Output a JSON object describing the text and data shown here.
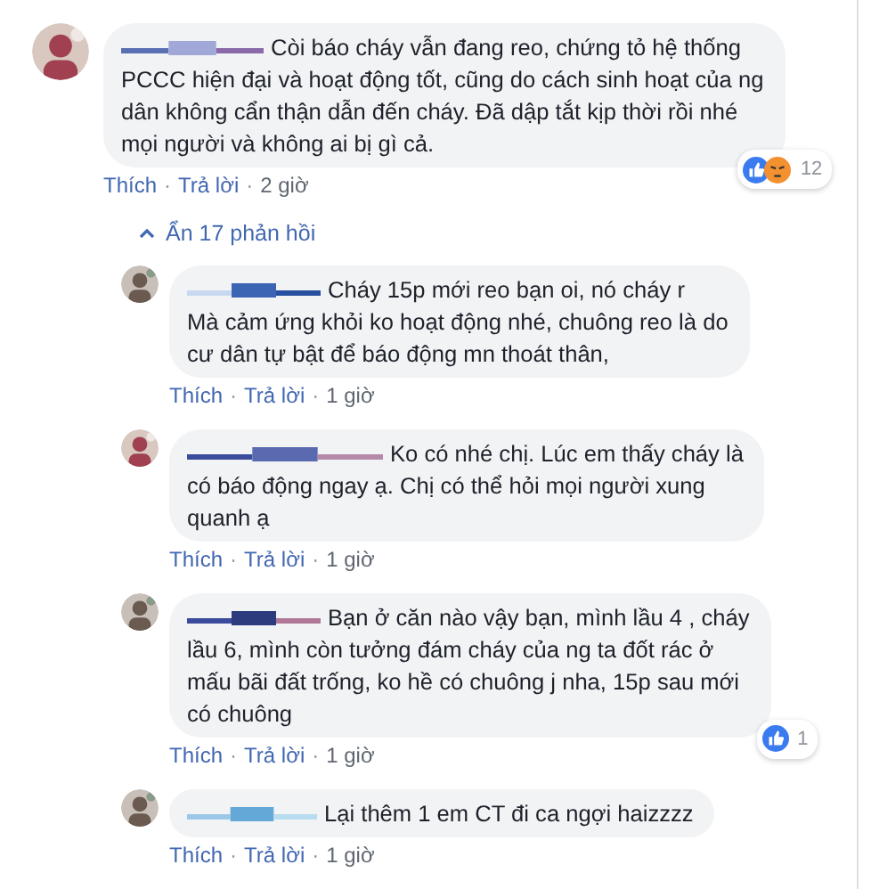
{
  "comment": {
    "lines": [
      "Còi báo cháy vẫn đang reo, chứng tỏ hệ thống",
      "PCCC hiện đại và hoạt động tốt, cũng do cách sinh hoạt của ng",
      "dân không cẩn thận dẫn đến cháy. Đã dập tắt kịp thời rồi nhé",
      "mọi người và không ai bị gì cả."
    ],
    "reactions": {
      "items": [
        {
          "kind": "like"
        },
        {
          "kind": "angry"
        }
      ],
      "count": "12"
    },
    "actions": [
      "Thích",
      "Trả lời",
      "2 giờ"
    ]
  },
  "separator": "·",
  "replies_toggle": "Ẩn 17 phản hồi",
  "replies": [
    {
      "lines": [
        "Cháy 15p mới reo bạn oi, nó cháy r",
        "Mà cảm ứng khỏi ko hoạt động nhé, chuông reo là do",
        "cư dân tự bật để báo động mn thoát thân,"
      ],
      "actions": [
        "Thích",
        "Trả lời",
        "1 giờ"
      ]
    },
    {
      "lines": [
        "Ko có nhé chị. Lúc em thấy cháy là",
        "có báo động ngay ạ. Chị có thể hỏi mọi người xung",
        "quanh ạ"
      ],
      "actions": [
        "Thích",
        "Trả lời",
        "1 giờ"
      ]
    },
    {
      "lines": [
        "Bạn ở căn nào vậy bạn, mình lầu 4 , cháy",
        "lầu 6, mình còn tưởng đám cháy của ng ta đốt rác ở",
        "mấu bãi đất trống, ko hề có chuông j nha, 15p sau mới",
        "có chuông"
      ],
      "reactions": {
        "items": [
          {
            "kind": "like"
          }
        ],
        "count": "1"
      },
      "actions": [
        "Thích",
        "Trả lời",
        "1 giờ"
      ]
    },
    {
      "lines": [
        "Lại thêm 1 em CT đi ca ngợi haizzzz"
      ],
      "actions": [
        "Thích",
        "Trả lời",
        "1 giờ"
      ]
    }
  ]
}
